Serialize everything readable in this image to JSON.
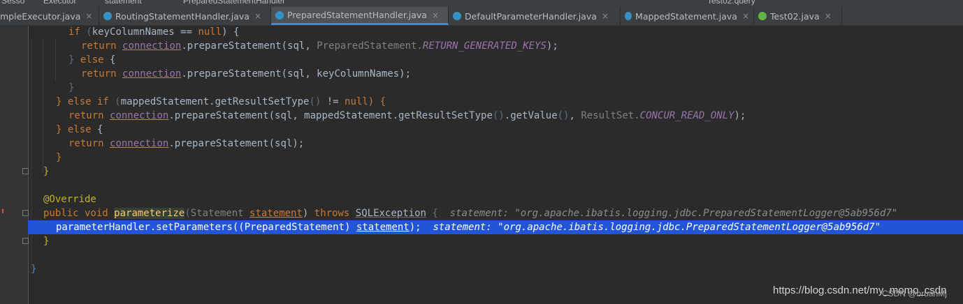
{
  "breadcrumb": {
    "items": [
      "Sesso",
      "Executor",
      "statement",
      "PreparedStatementHandler"
    ],
    "run_config": "Test02.query"
  },
  "tabs": [
    {
      "label": "mpleExecutor.java",
      "icon": "class-icon",
      "active": false
    },
    {
      "label": "RoutingStatementHandler.java",
      "icon": "class-icon",
      "active": false
    },
    {
      "label": "PreparedStatementHandler.java",
      "icon": "class-icon",
      "active": true
    },
    {
      "label": "DefaultParameterHandler.java",
      "icon": "class-icon",
      "active": false
    },
    {
      "label": "MappedStatement.java",
      "icon": "class-icon",
      "active": false
    },
    {
      "label": "Test02.java",
      "icon": "class-icon",
      "active": false
    }
  ],
  "tab_close_glyph": "×",
  "code": {
    "l1": {
      "a": "if ",
      "b": "(",
      "c": "keyColumnNames == ",
      "d": "null",
      "e": ") {"
    },
    "l2": {
      "a": "return ",
      "b": "connection",
      "c": ".prepareStatement(sql, ",
      "d": "PreparedStatement.",
      "e": "RETURN_GENERATED_KEYS",
      "f": ");"
    },
    "l3": {
      "a": "} ",
      "b": "else",
      "c": " {"
    },
    "l4": {
      "a": "return ",
      "b": "connection",
      "c": ".prepareStatement(sql, keyColumnNames);"
    },
    "l5": {
      "a": "}"
    },
    "l6": {
      "a": "} ",
      "b": "else if ",
      "c": "(",
      "d": "mappedStatement.getResultSetType",
      "e": "()",
      "f": " != ",
      "g": "null",
      "h": ") {"
    },
    "l7": {
      "a": "return ",
      "b": "connection",
      "c": ".prepareStatement(sql, mappedStatement.getResultSetType",
      "d": "()",
      "e": ".getValue",
      "f": "()",
      "g": ", ",
      "h": "ResultSet.",
      "i": "CONCUR_READ_ONLY",
      "j": ");"
    },
    "l8": {
      "a": "} ",
      "b": "else",
      "c": " {"
    },
    "l9": {
      "a": "return ",
      "b": "connection",
      "c": ".prepareStatement(sql);"
    },
    "l10": {
      "a": "}"
    },
    "l11": {
      "a": "}"
    },
    "l12": {
      "a": "@Override"
    },
    "l13": {
      "a": "public void ",
      "b": "parameterize",
      "c": "(",
      "d": "Statement ",
      "e": "statement",
      "f": ") ",
      "g": "throws ",
      "h": "SQLException",
      "i": " {  ",
      "j": "statement: \"org.apache.ibatis.logging.jdbc.PreparedStatementLogger@5ab956d7\""
    },
    "l14": {
      "a": "parameterHandler.setParameters((PreparedStatement) ",
      "b": "statement",
      "c": ");  ",
      "d": "statement: \"org.apache.ibatis.logging.jdbc.PreparedStatementLogger@5ab956d7\""
    },
    "l15": {
      "a": "}"
    },
    "l16": {
      "a": "}"
    }
  },
  "watermark": {
    "url": "https://blog.csdn.net/m",
    "user": "CSDN @bruanMj",
    "tail": "y_momo_csdn"
  },
  "colors": {
    "background": "#2b2b2b",
    "selected_line": "#2154d6",
    "keyword": "#cc7832",
    "field": "#9876aa",
    "annotation": "#bbb529",
    "active_tab_underline": "#4a88c7"
  }
}
